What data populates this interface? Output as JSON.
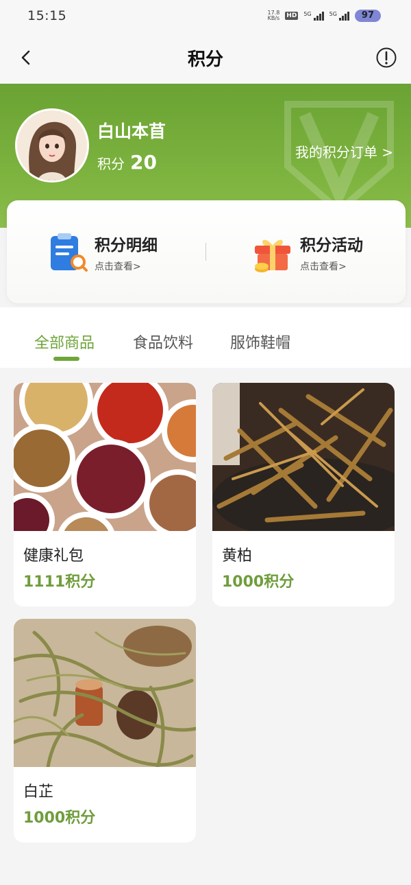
{
  "status_bar": {
    "time": "15:15",
    "net_speed_value": "17.8",
    "net_speed_unit": "KB/s",
    "hd_label": "HD",
    "sim1_label": "5G",
    "sim2_label": "5G",
    "battery": "97"
  },
  "nav": {
    "title": "积分"
  },
  "profile": {
    "name": "白山本苜",
    "points_label": "积分",
    "points_value": "20",
    "orders_link": "我的积分订单 >"
  },
  "menu": {
    "items": [
      {
        "title": "积分明细",
        "subtitle": "点击查看>"
      },
      {
        "title": "积分活动",
        "subtitle": "点击查看>"
      }
    ]
  },
  "tabs": [
    {
      "label": "全部商品",
      "active": true
    },
    {
      "label": "食品饮料",
      "active": false
    },
    {
      "label": "服饰鞋帽",
      "active": false
    }
  ],
  "products": [
    {
      "name": "健康礼包",
      "points": "1111积分"
    },
    {
      "name": "黄柏",
      "points": "1000积分"
    },
    {
      "name": "白芷",
      "points": "1000积分"
    }
  ],
  "colors": {
    "accent": "#6fa53a",
    "banner": "#7cb23e",
    "points_text": "#6f9d3c"
  }
}
